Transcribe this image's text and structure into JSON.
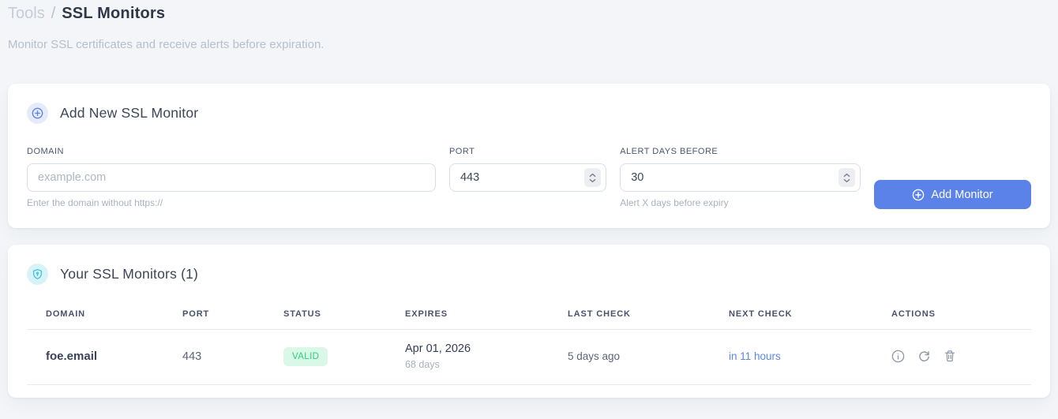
{
  "breadcrumb": {
    "section": "Tools",
    "separator": "/",
    "current": "SSL Monitors"
  },
  "subtitle": "Monitor SSL certificates and receive alerts before expiration.",
  "add_card": {
    "title": "Add New SSL Monitor",
    "fields": {
      "domain": {
        "label": "DOMAIN",
        "placeholder": "example.com",
        "value": "",
        "help": "Enter the domain without https://"
      },
      "port": {
        "label": "PORT",
        "value": "443"
      },
      "alert_days": {
        "label": "ALERT DAYS BEFORE",
        "value": "30",
        "help": "Alert X days before expiry"
      }
    },
    "submit_label": "Add Monitor"
  },
  "monitors_card": {
    "title": "Your SSL Monitors (1)",
    "table": {
      "headers": [
        "DOMAIN",
        "PORT",
        "STATUS",
        "EXPIRES",
        "LAST CHECK",
        "NEXT CHECK",
        "ACTIONS"
      ],
      "rows": [
        {
          "domain": "foe.email",
          "port": "443",
          "status": "VALID",
          "expires_date": "Apr 01, 2026",
          "expires_in": "68 days",
          "last_check": "5 days ago",
          "next_check": "in 11 hours"
        }
      ]
    }
  },
  "icons": {
    "add_card_header": "plus-circle-icon",
    "monitors_card_header": "shield-icon",
    "row_actions": [
      "info-icon",
      "refresh-icon",
      "trash-icon"
    ]
  },
  "colors": {
    "accent_blue": "#5b82e8",
    "link_blue": "#5c85ea",
    "badge_blue_bg": "#e5ebfb",
    "badge_cyan_bg": "#d8f3f8",
    "shield_cyan": "#35c4dc",
    "valid_bg": "#d9f8e8",
    "valid_text": "#2fcf7d",
    "page_bg": "#f3f5f8"
  }
}
